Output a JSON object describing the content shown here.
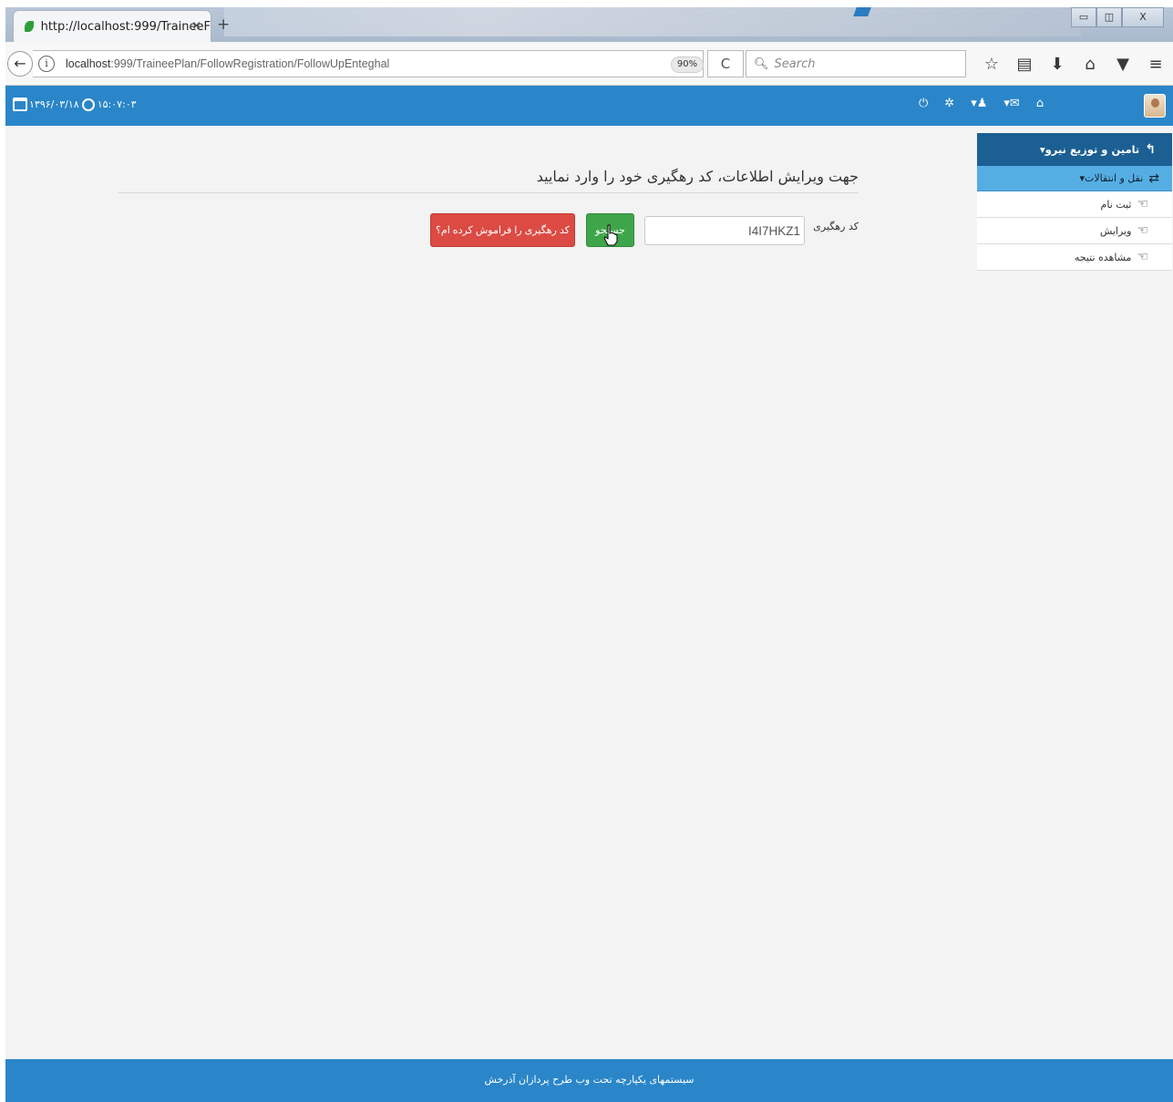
{
  "browser": {
    "tab_title": "http://localhost:999/TraineeF",
    "tab_close": "×",
    "new_tab": "+",
    "window_controls": {
      "minimize": "▭",
      "restore": "◫",
      "close": "X"
    },
    "back": "←",
    "info": "i",
    "url_host": "localhost",
    "url_rest": ":999/TraineePlan/FollowRegistration/FollowUpEnteghal",
    "zoom": "90%",
    "reload": "C",
    "search_placeholder": "Search",
    "toolbar_icons": [
      "star-icon",
      "reading-list-icon",
      "download-icon",
      "home-icon",
      "pocket-icon",
      "menu-icon"
    ]
  },
  "header": {
    "date": "۱۳۹۶/۰۳/۱۸",
    "time": "۱۵:۰۷:۰۳",
    "icons": [
      "power-icon",
      "gear-icon",
      "bell-icon",
      "mail-icon",
      "home-icon"
    ],
    "accent": "#2a86c8"
  },
  "sidebar": {
    "title": "تامین و توزیع نیرو",
    "section": "نقل و انتقالات",
    "items": [
      {
        "label": "ثبت نام"
      },
      {
        "label": "ویرایش"
      },
      {
        "label": "مشاهده نتیجه"
      }
    ]
  },
  "main": {
    "heading": "جهت ویرایش اطلاعات، کد رهگیری خود را وارد نمایید",
    "code_label": "کد رهگیری",
    "code_value": "I4I7HKZ1",
    "search_button": "جستجو",
    "forgot_button": "کد رهگیری را فراموش کرده ام؟"
  },
  "footer": {
    "text": "سیستمهای یکپارچه تحت وب طرح پردازان آذرخش"
  }
}
